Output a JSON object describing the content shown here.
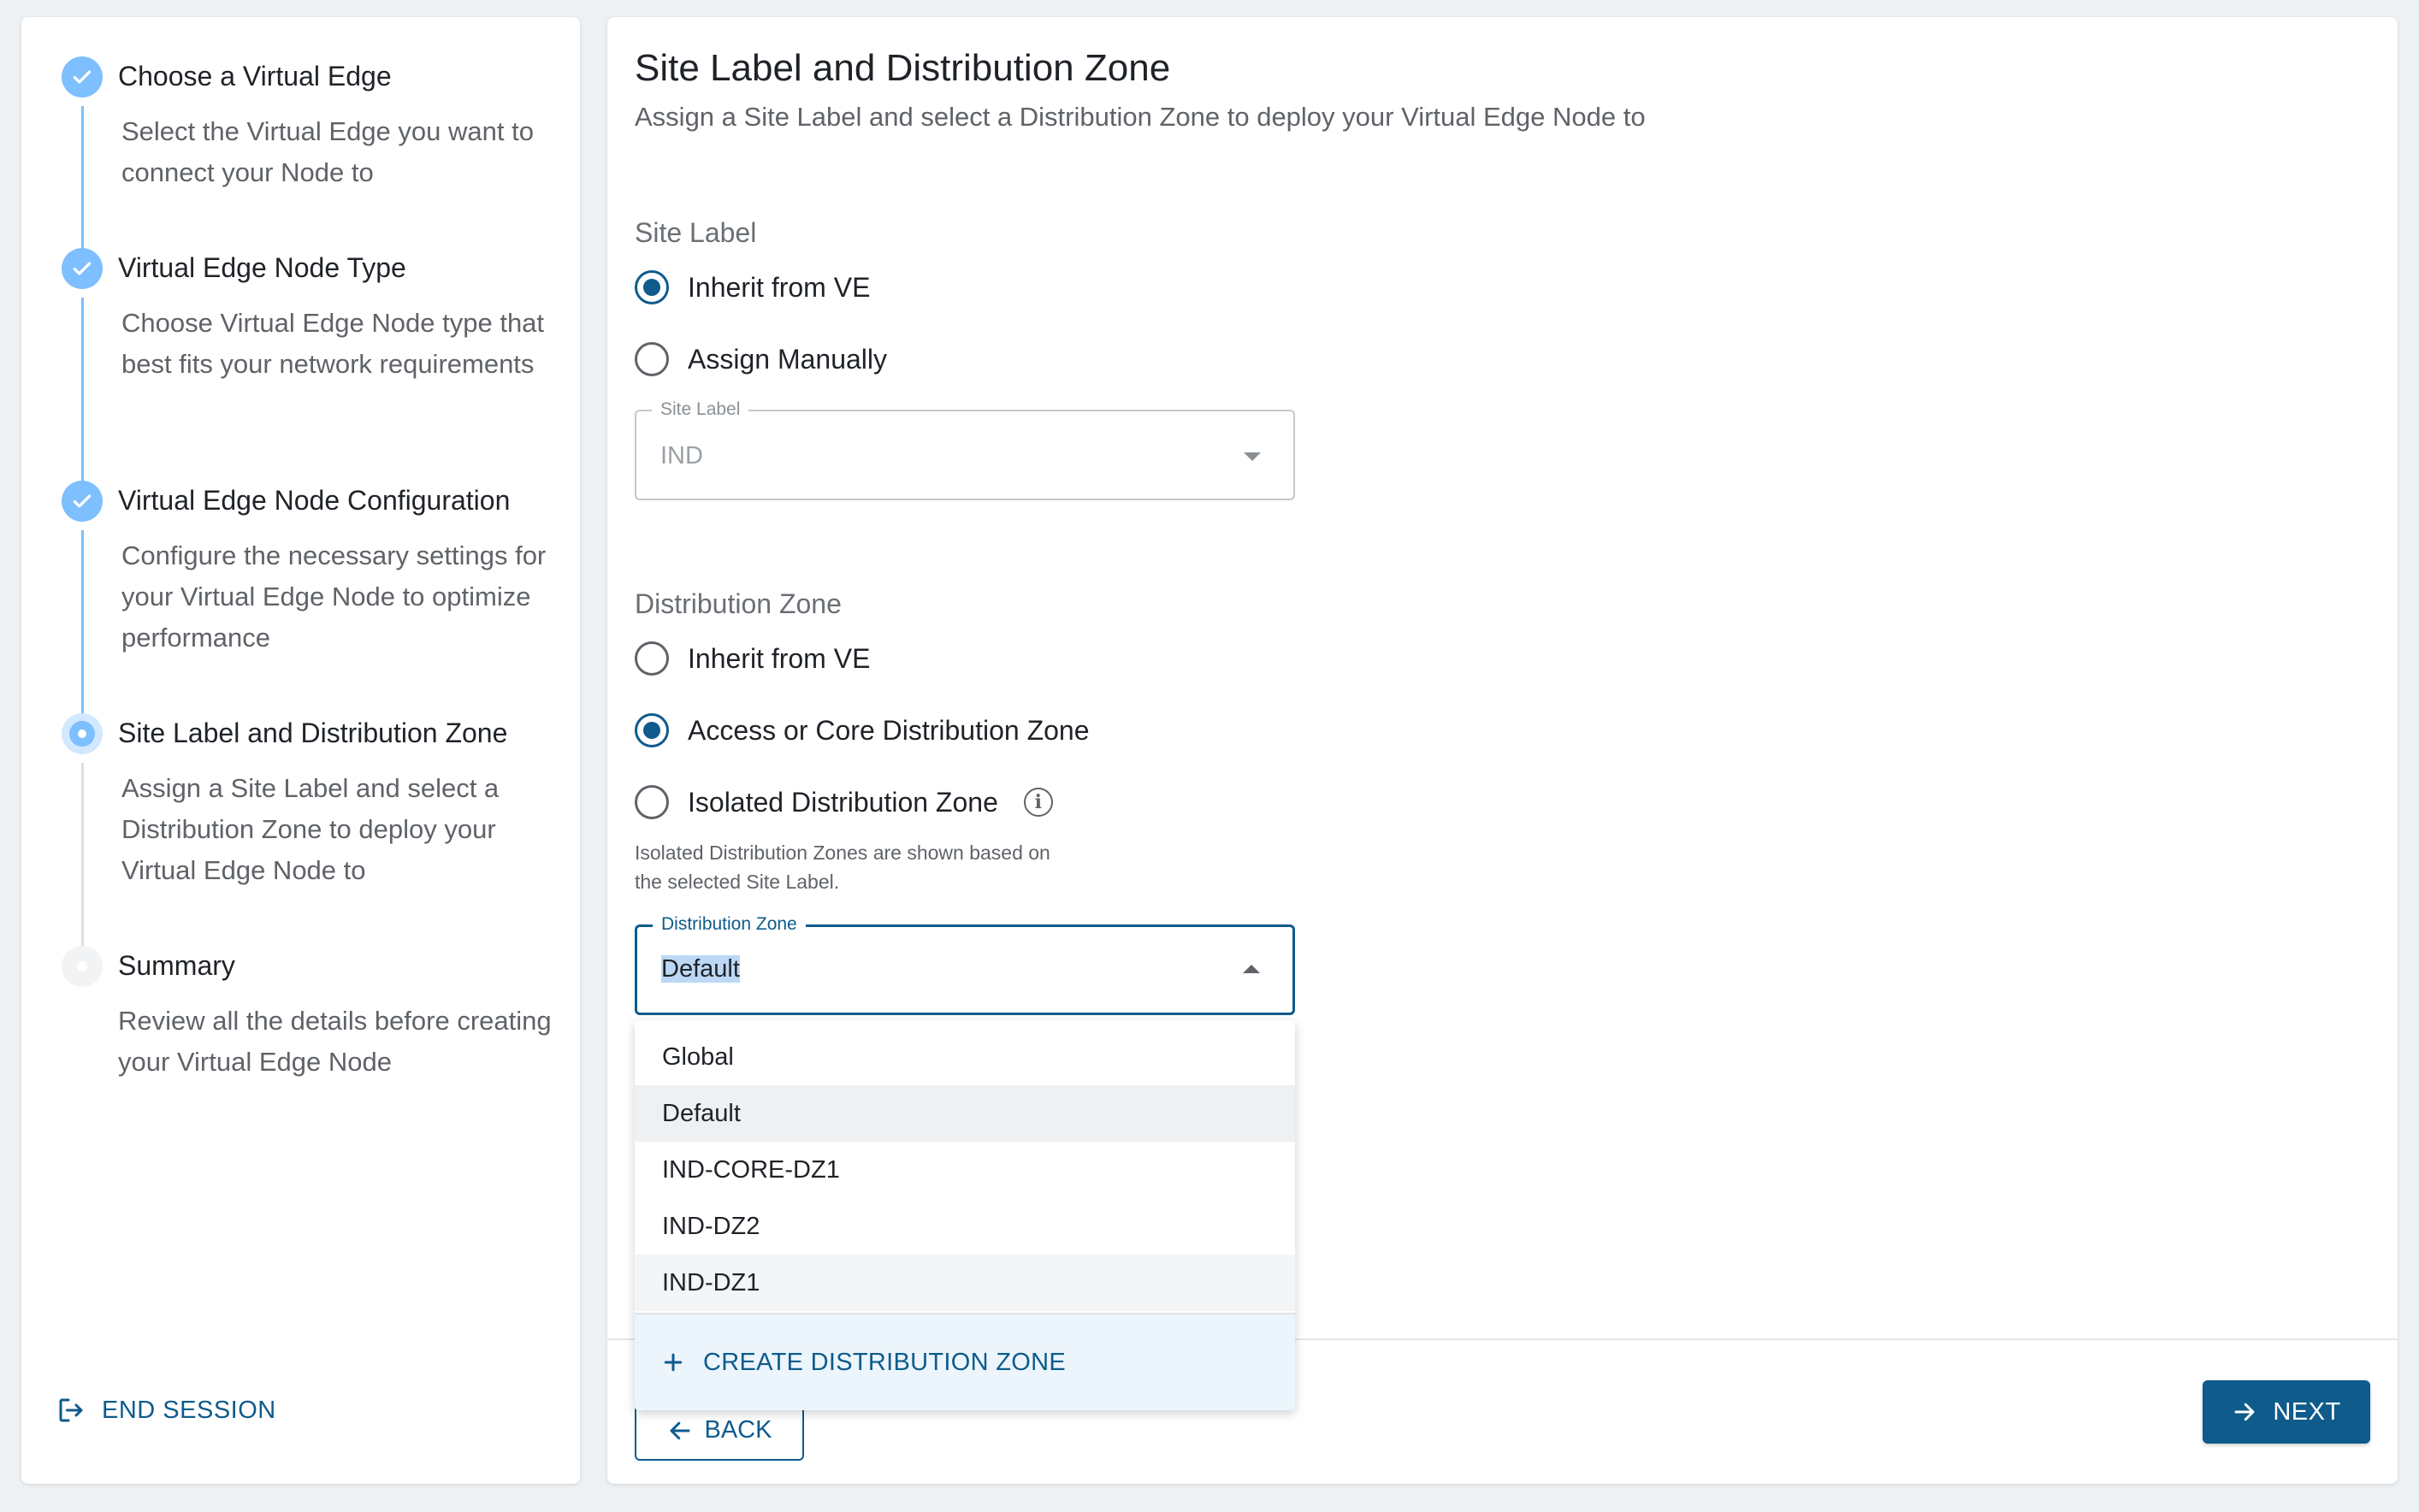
{
  "stepper": {
    "steps": [
      {
        "title": "Choose a Virtual Edge",
        "desc": "Select the Virtual Edge you want to connect your Node to",
        "state": "done"
      },
      {
        "title": "Virtual Edge Node Type",
        "desc": "Choose Virtual Edge Node type that best fits your network requirements",
        "state": "done"
      },
      {
        "title": "Virtual Edge Node Configuration",
        "desc": "Configure the necessary settings for your Virtual Edge Node to optimize performance",
        "state": "done"
      },
      {
        "title": "Site Label and Distribution Zone",
        "desc": "Assign a Site Label and select a Distribution Zone to deploy your Virtual Edge Node to",
        "state": "active"
      },
      {
        "title": "Summary",
        "desc": "Review all the details before creating your Virtual Edge Node",
        "state": "pending"
      }
    ],
    "end_session_label": "END SESSION"
  },
  "main": {
    "title": "Site Label and Distribution Zone",
    "subtitle": "Assign a Site Label and select a Distribution Zone to deploy your Virtual Edge Node to",
    "site_label": {
      "section_label": "Site Label",
      "options": [
        "Inherit from VE",
        "Assign Manually"
      ],
      "selected_index": 0,
      "field_legend": "Site Label",
      "field_value": "IND"
    },
    "distribution_zone": {
      "section_label": "Distribution Zone",
      "options": [
        "Inherit from VE",
        "Access or Core Distribution Zone",
        "Isolated Distribution Zone"
      ],
      "selected_index": 1,
      "helper_text": "Isolated Distribution Zones are shown based on the selected Site Label.",
      "field_legend": "Distribution Zone",
      "field_value": "Default",
      "menu_items": [
        "Global",
        "Default",
        "IND-CORE-DZ1",
        "IND-DZ2",
        "IND-DZ1"
      ],
      "create_label": "CREATE DISTRIBUTION ZONE"
    },
    "back_label": "BACK",
    "next_label": "NEXT"
  },
  "colors": {
    "accent": "#0e5b8c",
    "step_done": "#7dbfff"
  }
}
